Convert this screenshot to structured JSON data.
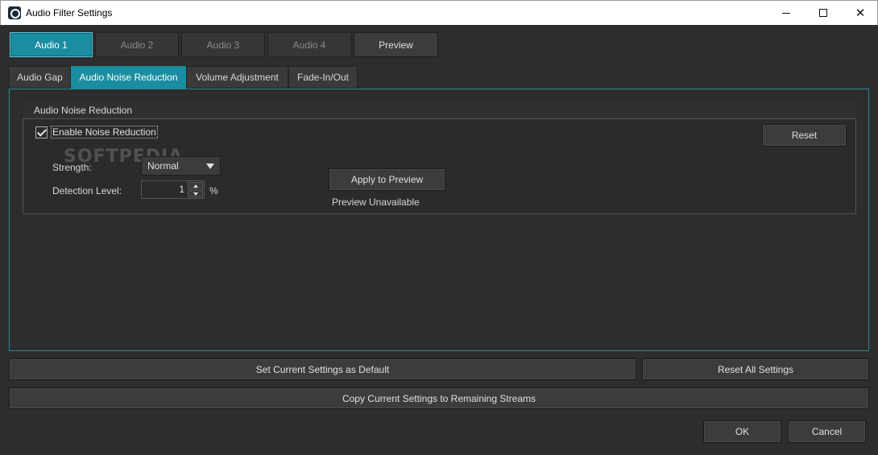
{
  "window": {
    "title": "Audio Filter Settings"
  },
  "stream_tabs": [
    "Audio 1",
    "Audio 2",
    "Audio 3",
    "Audio 4"
  ],
  "preview_tab": "Preview",
  "sub_tabs": [
    "Audio Gap",
    "Audio Noise Reduction",
    "Volume Adjustment",
    "Fade-In/Out"
  ],
  "active_sub_tab": "Audio Noise Reduction",
  "group": {
    "title": "Audio Noise Reduction",
    "enable_label": "Enable Noise Reduction",
    "enable_checked": true,
    "strength_label": "Strength:",
    "strength_value": "Normal",
    "detection_label": "Detection Level:",
    "detection_value": "1",
    "detection_unit": "%",
    "apply_button": "Apply to Preview",
    "preview_status": "Preview Unavailable",
    "reset_button": "Reset"
  },
  "watermark": "SOFTPEDIA",
  "footer": {
    "set_default": "Set Current Settings as Default",
    "reset_all": "Reset All Settings",
    "copy_settings": "Copy Current Settings to Remaining Streams",
    "ok": "OK",
    "cancel": "Cancel"
  },
  "colors": {
    "accent": "#1a8da0",
    "background": "#2d2d2d"
  }
}
